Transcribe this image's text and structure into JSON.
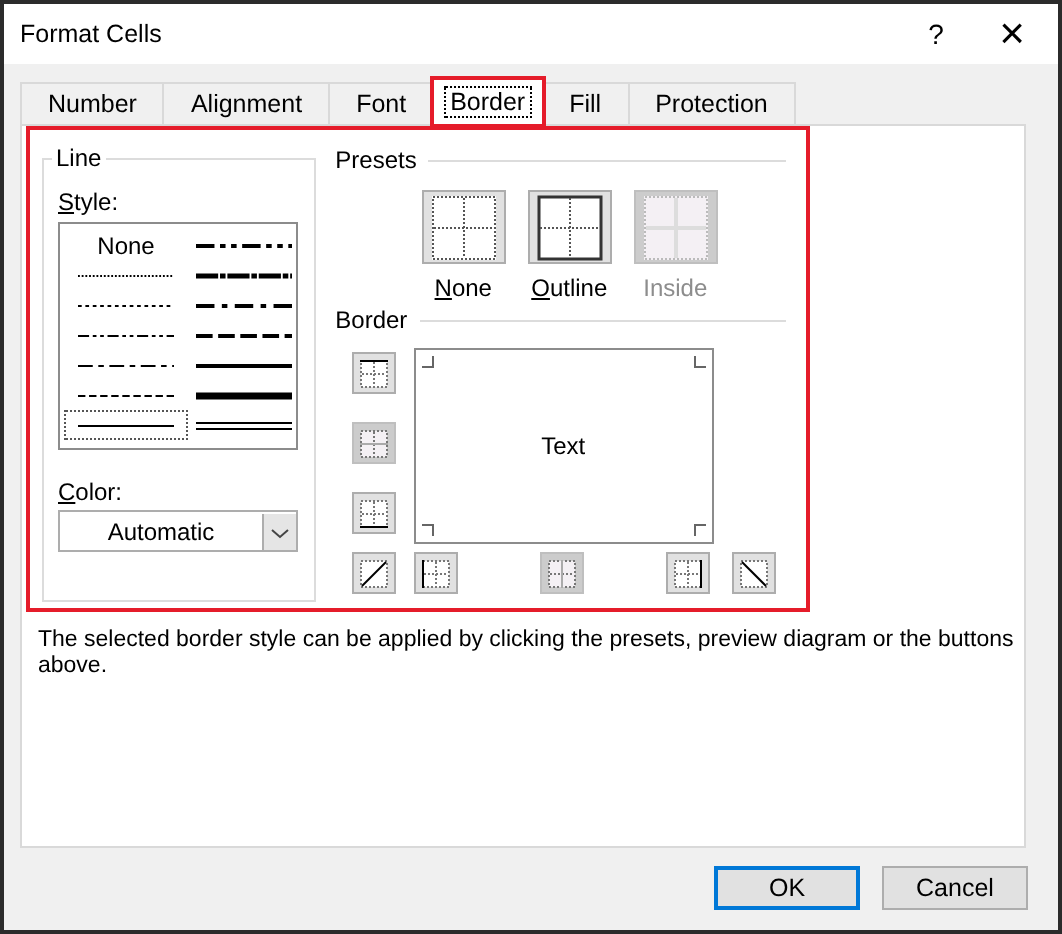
{
  "window": {
    "title": "Format Cells",
    "help": "?",
    "close": "×"
  },
  "tabs": [
    {
      "label": "Number",
      "selected": false,
      "highlighted": false
    },
    {
      "label": "Alignment",
      "selected": false,
      "highlighted": false
    },
    {
      "label": "Font",
      "selected": false,
      "highlighted": false
    },
    {
      "label": "Border",
      "selected": true,
      "highlighted": true
    },
    {
      "label": "Fill",
      "selected": false,
      "highlighted": false
    },
    {
      "label": "Protection",
      "selected": false,
      "highlighted": false
    }
  ],
  "panel_highlighted": true,
  "line": {
    "title": "Line",
    "style_label": "Style:",
    "styles": [
      {
        "kind": "none",
        "label": "None",
        "selected": false
      },
      {
        "kind": "hair",
        "selected": false
      },
      {
        "kind": "dotted",
        "selected": false
      },
      {
        "kind": "dash-dot-dot",
        "selected": false
      },
      {
        "kind": "dash-dot",
        "selected": false
      },
      {
        "kind": "dashed",
        "selected": false
      },
      {
        "kind": "thin",
        "selected": true
      },
      {
        "kind": "medium-dash-dot-dot",
        "selected": false
      },
      {
        "kind": "slanted-dash-dot",
        "selected": false
      },
      {
        "kind": "medium-dash-dot",
        "selected": false
      },
      {
        "kind": "medium-dashed",
        "selected": false
      },
      {
        "kind": "medium",
        "selected": false
      },
      {
        "kind": "thick",
        "selected": false
      },
      {
        "kind": "double",
        "selected": false
      }
    ],
    "color_label": "Color:",
    "color_value": "Automatic"
  },
  "presets": {
    "title": "Presets",
    "items": [
      {
        "kind": "none",
        "label": "None",
        "disabled": false
      },
      {
        "kind": "outline",
        "label": "Outline",
        "disabled": false
      },
      {
        "kind": "inside",
        "label": "Inside",
        "disabled": true
      }
    ]
  },
  "border": {
    "title": "Border",
    "preview_text": "Text",
    "left_buttons": [
      {
        "kind": "top",
        "disabled": false
      },
      {
        "kind": "middle-h",
        "disabled": true
      },
      {
        "kind": "bottom",
        "disabled": false
      }
    ],
    "bottom_buttons": [
      {
        "kind": "diag-up",
        "disabled": false
      },
      {
        "kind": "left",
        "disabled": false
      },
      {
        "kind": "middle-v",
        "disabled": true
      },
      {
        "kind": "right",
        "disabled": false
      },
      {
        "kind": "diag-down",
        "disabled": false
      }
    ]
  },
  "description": "The selected border style can be applied by clicking the presets, preview diagram or the buttons above.",
  "buttons": [
    {
      "label": "OK",
      "default": true
    },
    {
      "label": "Cancel",
      "default": false
    }
  ]
}
